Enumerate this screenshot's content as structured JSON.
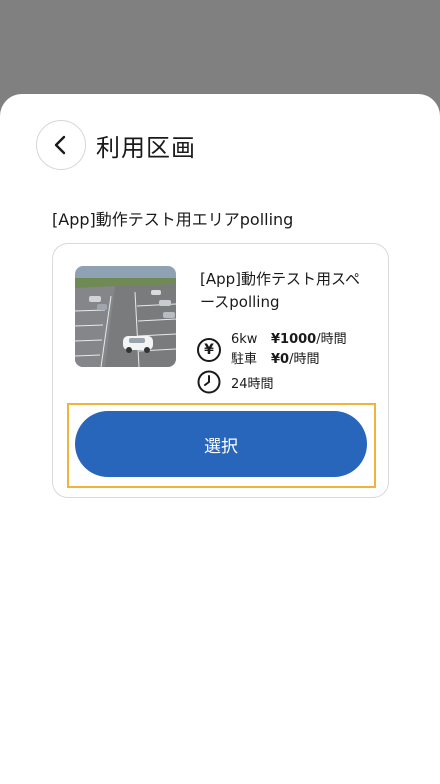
{
  "header": {
    "title": "利用区画",
    "back_icon": "chevron-left-icon"
  },
  "area": {
    "name": "[App]動作テスト用エリアpolling"
  },
  "space_card": {
    "name": "[App]動作テスト用スペースpolling",
    "image": "parking-lot-photo",
    "price": {
      "icon": "yen-icon",
      "rows": [
        {
          "label": "6kw",
          "amount": "¥1000",
          "unit": "/時間"
        },
        {
          "label": "駐車",
          "amount": "¥0",
          "unit": "/時間"
        }
      ]
    },
    "hours": {
      "icon": "clock-icon",
      "text": "24時間"
    },
    "select_label": "選択"
  },
  "colors": {
    "overlay": "#808080",
    "primary_button": "#2766bb",
    "focus_outline": "#f0b43c"
  }
}
